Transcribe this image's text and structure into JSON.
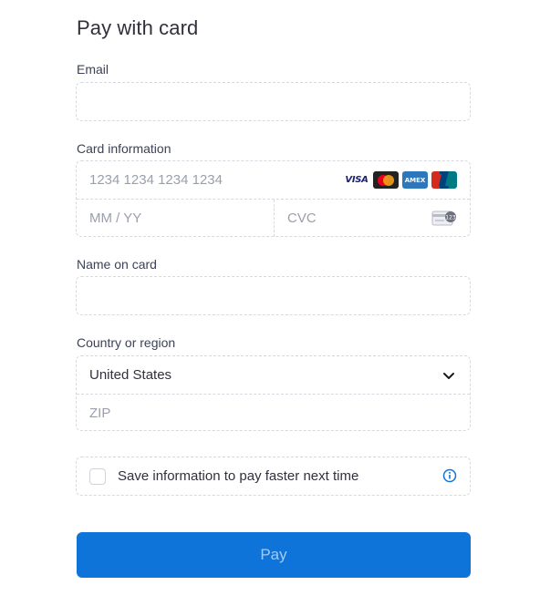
{
  "title": "Pay with card",
  "email": {
    "label": "Email",
    "value": "",
    "placeholder": ""
  },
  "card": {
    "label": "Card information",
    "number_placeholder": "1234 1234 1234 1234",
    "expiry_placeholder": "MM / YY",
    "cvc_placeholder": "CVC",
    "brands": [
      {
        "name": "visa-icon",
        "text": "VISA"
      },
      {
        "name": "mastercard-icon",
        "text": ""
      },
      {
        "name": "amex-icon",
        "text": "AMEX"
      },
      {
        "name": "unionpay-icon",
        "text": "UnionPay"
      }
    ]
  },
  "name": {
    "label": "Name on card",
    "value": ""
  },
  "country": {
    "label": "Country or region",
    "selected": "United States",
    "zip_placeholder": "ZIP"
  },
  "save": {
    "label": "Save information to pay faster next time",
    "checked": false
  },
  "pay": {
    "label": "Pay"
  },
  "colors": {
    "accent": "#0f74d9",
    "pay_text": "#a8c9ee",
    "border": "#d6d9e0"
  }
}
